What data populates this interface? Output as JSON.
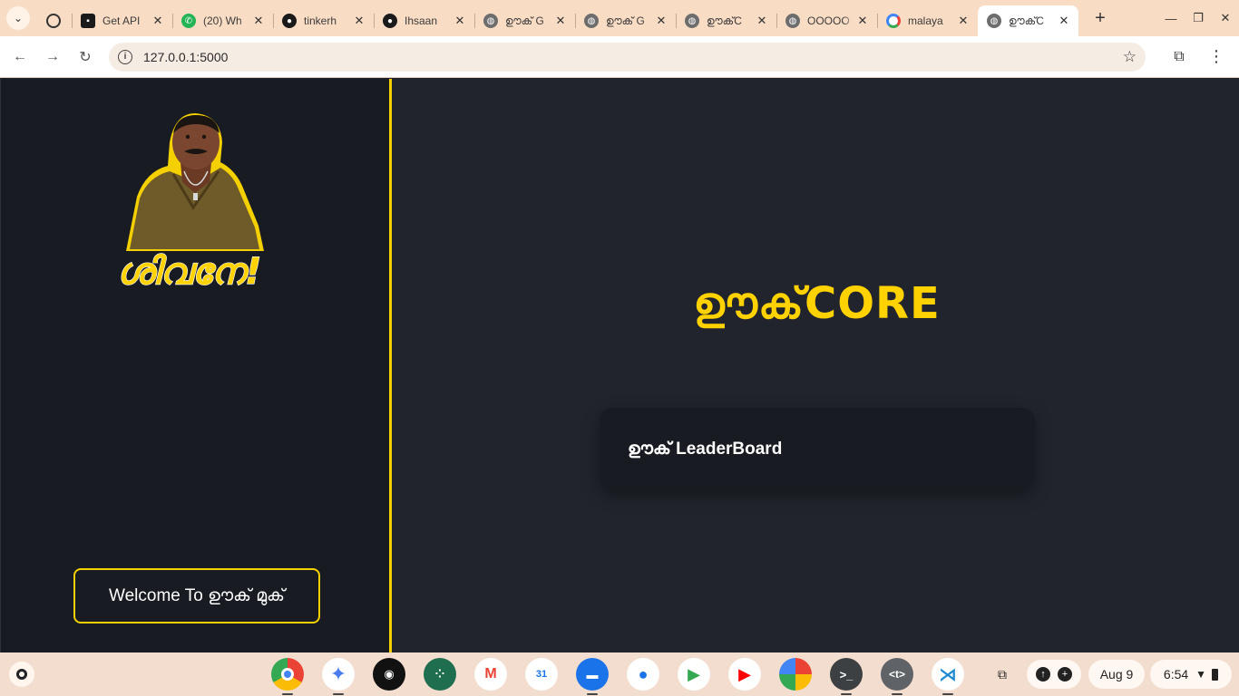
{
  "browser": {
    "tabs": [
      {
        "title": "",
        "favicon": "openai-icon",
        "pinned": true
      },
      {
        "title": "Get API",
        "favicon": "square-logo-icon"
      },
      {
        "title": "(20) Wh",
        "favicon": "whatsapp-icon"
      },
      {
        "title": "tinkerh",
        "favicon": "github-icon"
      },
      {
        "title": "Ihsaan",
        "favicon": "github-icon"
      },
      {
        "title": "ഊക് G",
        "favicon": "globe-icon"
      },
      {
        "title": "ഊക് G",
        "favicon": "globe-icon"
      },
      {
        "title": "ഊക്C",
        "favicon": "globe-icon"
      },
      {
        "title": "OOOOO",
        "favicon": "globe-icon"
      },
      {
        "title": "malaya",
        "favicon": "google-icon"
      },
      {
        "title": "ഊക്C",
        "favicon": "globe-icon",
        "active": true
      }
    ],
    "url": "127.0.0.1:5000"
  },
  "page": {
    "sticker_caption": "ശിവനേ!",
    "welcome_button": "Welcome To ഊക് മുക്",
    "title": "ഊക്CORE",
    "leaderboard_label": "ഊക് LeaderBoard"
  },
  "shelf": {
    "date": "Aug 9",
    "time": "6:54"
  },
  "colors": {
    "accent_yellow": "#ffd200",
    "sidebar_bg": "#181b22",
    "main_bg": "#21242c"
  }
}
